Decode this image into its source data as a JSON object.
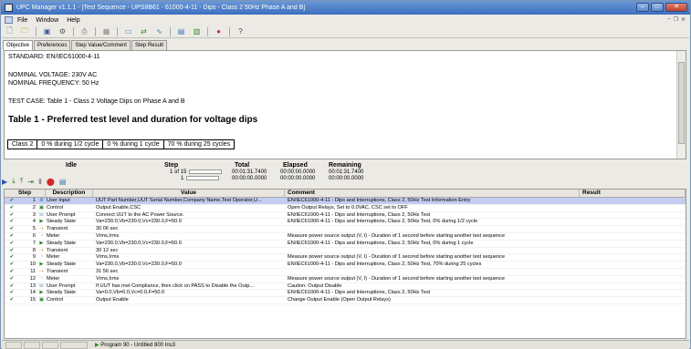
{
  "window": {
    "title": "UPC Manager v1.1.1 - [Test Sequence - UPS8B61 - 61000-4-11 - Dips - Class 2 50Hz Phase A and B]"
  },
  "menu": [
    "File",
    "Window",
    "Help"
  ],
  "tabs": [
    "Objective",
    "Preferences",
    "Step Value/Comment",
    "Step Result"
  ],
  "objective": {
    "standard": "STANDARD:  EN/IEC61000-4-11",
    "voltage": "NOMINAL VOLTAGE:   230V AC",
    "frequency": "NOMINAL FREQUENCY:   50 Hz",
    "test_case": "TEST CASE:   Table 1 - Class 2 Voltage Dips on Phase A and B",
    "table_title": "Table 1 - Preferred test level and duration for voltage dips",
    "levels": [
      "Class 2",
      "0 % during 1/2 cycle",
      "0 % during 1 cycle",
      "70 % during 25 cycles"
    ]
  },
  "status": {
    "idle": "Idle",
    "step_label": "Step",
    "step_val1": "1 of 15",
    "step_val2": "1",
    "total_label": "Total",
    "total_val1": "00:01:31.7400",
    "total_val2": "00:00:00.0000",
    "elapsed_label": "Elapsed",
    "elapsed_val1": "00:00:00.0000",
    "elapsed_val2": "00:00:00.0000",
    "remaining_label": "Remaining",
    "remaining_val1": "00:01:31.7400",
    "remaining_val2": "00:00:00.0000"
  },
  "grid": {
    "headers": [
      "Step",
      "Description",
      "Value",
      "Comment",
      "Result"
    ],
    "rows": [
      {
        "n": "1",
        "icon": "user-input",
        "desc": "User Input",
        "val": "UUT Part Number,UUT Serial Number,Company Name,Test Operator,U...",
        "com": "EN/IEC61000-4-11 - Dips and Interruptions, Class 2, 50Hz Test Information Entry"
      },
      {
        "n": "2",
        "icon": "control",
        "desc": "Control",
        "val": "Output Enable,CSC",
        "com": "Open Output Relays, Set to 0.0VAC, CSC set to OFF"
      },
      {
        "n": "3",
        "icon": "user-prompt",
        "desc": "User Prompt",
        "val": "Connect  UUT to the AC Power Source.",
        "com": "EN/IEC61000-4-11 - Dips and Interruptions, Class 2, 50Hz Test"
      },
      {
        "n": "4",
        "icon": "steady-state",
        "desc": "Steady State",
        "val": "Va=230.0,Vb=230.0,Vc=230.0,F=50.0",
        "com": "EN/IEC61000-4-11 - Dips and Interruptions, Class 2, 50Hz Test, 0% during 1/2 cycle"
      },
      {
        "n": "5",
        "icon": "transient",
        "desc": "Transient",
        "val": "30 06 sec",
        "com": ""
      },
      {
        "n": "6",
        "icon": "meter",
        "desc": "Meter",
        "val": "Vrms,Irms",
        "com": "Measure power source output (V, I) - Duration of 1 second before starting another test sequence"
      },
      {
        "n": "7",
        "icon": "steady-state",
        "desc": "Steady State",
        "val": "Va=230.0,Vb=230.0,Vc=230.0,F=50.0",
        "com": "EN/IEC61000-4-11 - Dips and Interruptions, Class 2, 50Hz Test, 0% during 1 cycle"
      },
      {
        "n": "8",
        "icon": "transient",
        "desc": "Transient",
        "val": "30 12 sec",
        "com": ""
      },
      {
        "n": "9",
        "icon": "meter",
        "desc": "Meter",
        "val": "Vrms,Irms",
        "com": "Measure power source output (V, I) - Duration of 1 second before starting another test sequence"
      },
      {
        "n": "10",
        "icon": "steady-state",
        "desc": "Steady State",
        "val": "Va=230.0,Vb=230.0,Vc=230.0,F=50.0",
        "com": "EN/IEC61000-4-11 - Dips and Interruptions, Class 2, 50Hz Test, 70% during 25 cycles"
      },
      {
        "n": "11",
        "icon": "transient",
        "desc": "Transient",
        "val": "31 56 sec",
        "com": ""
      },
      {
        "n": "12",
        "icon": "meter",
        "desc": "Meter",
        "val": "Vrms,Irms",
        "com": "Measure power source output (V, I) - Duration of 1 second before starting another test sequence"
      },
      {
        "n": "13",
        "icon": "user-prompt",
        "desc": "User Prompt",
        "val": "If UUT has met Compliance, then click on PASS to Disable the Outp...",
        "com": "Caution: Output Disable"
      },
      {
        "n": "14",
        "icon": "steady-state",
        "desc": "Steady State",
        "val": "Va=0.0,Vb=0.0,Vc=0.0,F=50.0",
        "com": "EN/IEC61000-4-11 - Dips and Interruptions, Class 2, 50Hz Test"
      },
      {
        "n": "15",
        "icon": "control",
        "desc": "Control",
        "val": "Output Enable",
        "com": "Change Output Enable (Open Output Relays)"
      }
    ]
  },
  "footer": {
    "program": "Program 90 - Untitled 800 Ins3"
  },
  "colors": {
    "selected_row": "#c4cdf0",
    "titlebar": "#3c6fbf",
    "check": "#1a6a1a"
  }
}
